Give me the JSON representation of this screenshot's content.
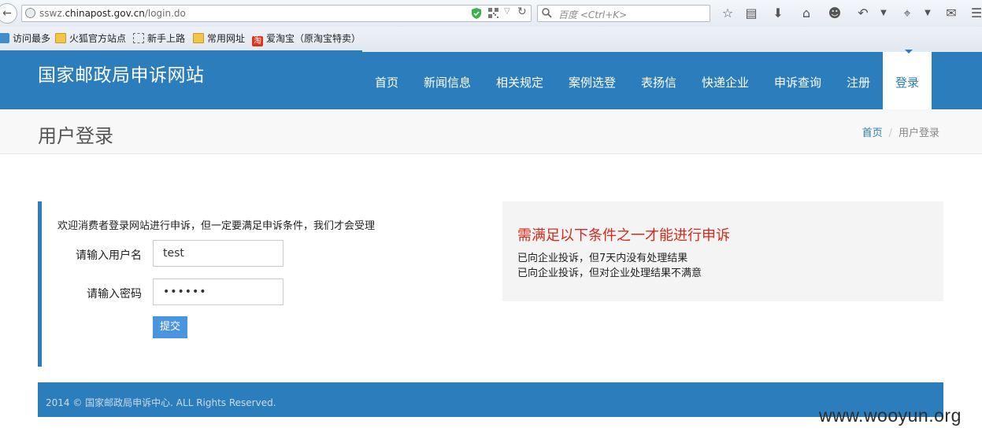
{
  "browser": {
    "url_prefix": "sswz.",
    "url_domain": "chinapost.gov.cn",
    "url_path": "/login.do",
    "search_placeholder": "百度 <Ctrl+K>"
  },
  "bookmarks": [
    {
      "label": "访问最多",
      "icon": "visit-icon"
    },
    {
      "label": "火狐官方站点",
      "icon": "folder-icon"
    },
    {
      "label": "新手上路",
      "icon": "dotted-icon"
    },
    {
      "label": "常用网址",
      "icon": "folder-icon"
    },
    {
      "label": "爱淘宝（原淘宝特卖）",
      "icon": "taobao-icon",
      "icon_glyph": "淘"
    }
  ],
  "header": {
    "logo": "国家邮政局申诉网站",
    "nav": [
      "首页",
      "新闻信息",
      "相关规定",
      "案例选登",
      "表扬信",
      "快递企业",
      "申诉查询",
      "注册",
      "登录"
    ],
    "active_nav": "登录"
  },
  "title_bar": {
    "title": "用户登录",
    "breadcrumb_home": "首页",
    "breadcrumb_sep": "/",
    "breadcrumb_current": "用户登录"
  },
  "login": {
    "welcome": "欢迎消费者登录网站进行申诉，但一定要满足申诉条件，我们才会受理",
    "username_label": "请输入用户名",
    "username_value": "test",
    "password_label": "请输入密码",
    "password_value": "••••••",
    "submit_label": "提交"
  },
  "conditions": {
    "title": "需满足以下条件之一才能进行申诉",
    "items": [
      "已向企业投诉，但7天内没有处理结果",
      "已向企业投诉，但对企业处理结果不满意"
    ]
  },
  "footer": {
    "text": "2014 © 国家邮政局申诉中心. ALL Rights Reserved."
  },
  "watermark": "www.wooyun.org",
  "colors": {
    "brand_blue": "#2b7dbc",
    "button_blue": "#4b94df",
    "alert_red": "#d6291c"
  }
}
